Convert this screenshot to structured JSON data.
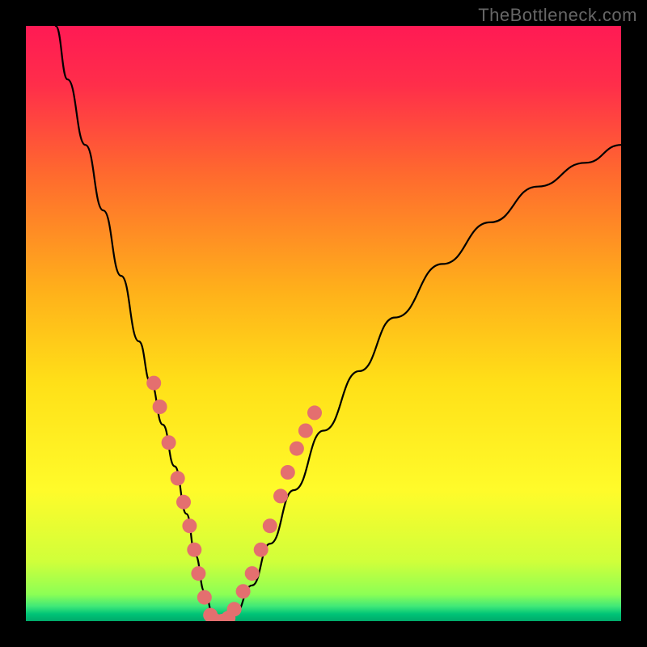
{
  "watermark": "TheBottleneck.com",
  "gradient_stops": [
    {
      "offset": 0,
      "color": "#ff1a54"
    },
    {
      "offset": 0.1,
      "color": "#ff2e4a"
    },
    {
      "offset": 0.25,
      "color": "#ff6a2e"
    },
    {
      "offset": 0.45,
      "color": "#ffb21a"
    },
    {
      "offset": 0.6,
      "color": "#ffe018"
    },
    {
      "offset": 0.78,
      "color": "#fffb2a"
    },
    {
      "offset": 0.9,
      "color": "#d0ff3a"
    },
    {
      "offset": 0.955,
      "color": "#8cff55"
    },
    {
      "offset": 0.975,
      "color": "#40e878"
    },
    {
      "offset": 0.988,
      "color": "#00c477"
    },
    {
      "offset": 1.0,
      "color": "#00a96a"
    }
  ],
  "chart_data": {
    "type": "line",
    "title": "",
    "xlabel": "",
    "ylabel": "",
    "xlim": [
      0,
      100
    ],
    "ylim": [
      0,
      100
    ],
    "grid": false,
    "legend": false,
    "series": [
      {
        "name": "curve",
        "stroke": "#000000",
        "x": [
          5,
          7,
          10,
          13,
          16,
          19,
          21,
          23,
          25,
          27,
          28.5,
          30,
          31.5,
          33,
          35,
          38,
          41,
          45,
          50,
          56,
          62,
          70,
          78,
          86,
          94,
          100
        ],
        "y": [
          100,
          91,
          80,
          69,
          58,
          47,
          40,
          33,
          26,
          18,
          11,
          5,
          1,
          0,
          1,
          6,
          13,
          22,
          32,
          42,
          51,
          60,
          67,
          73,
          77,
          80
        ]
      }
    ],
    "scatter": {
      "name": "dots",
      "fill": "#e46f6f",
      "points": [
        {
          "x": 21.5,
          "y": 40
        },
        {
          "x": 22.5,
          "y": 36
        },
        {
          "x": 24.0,
          "y": 30
        },
        {
          "x": 25.5,
          "y": 24
        },
        {
          "x": 26.5,
          "y": 20
        },
        {
          "x": 27.5,
          "y": 16
        },
        {
          "x": 28.3,
          "y": 12
        },
        {
          "x": 29.0,
          "y": 8
        },
        {
          "x": 30.0,
          "y": 4
        },
        {
          "x": 31.0,
          "y": 1
        },
        {
          "x": 32.0,
          "y": 0
        },
        {
          "x": 33.0,
          "y": 0
        },
        {
          "x": 34.0,
          "y": 0.5
        },
        {
          "x": 35.0,
          "y": 2
        },
        {
          "x": 36.5,
          "y": 5
        },
        {
          "x": 38.0,
          "y": 8
        },
        {
          "x": 39.5,
          "y": 12
        },
        {
          "x": 41.0,
          "y": 16
        },
        {
          "x": 42.8,
          "y": 21
        },
        {
          "x": 44.0,
          "y": 25
        },
        {
          "x": 45.5,
          "y": 29
        },
        {
          "x": 47.0,
          "y": 32
        },
        {
          "x": 48.5,
          "y": 35
        }
      ]
    }
  }
}
